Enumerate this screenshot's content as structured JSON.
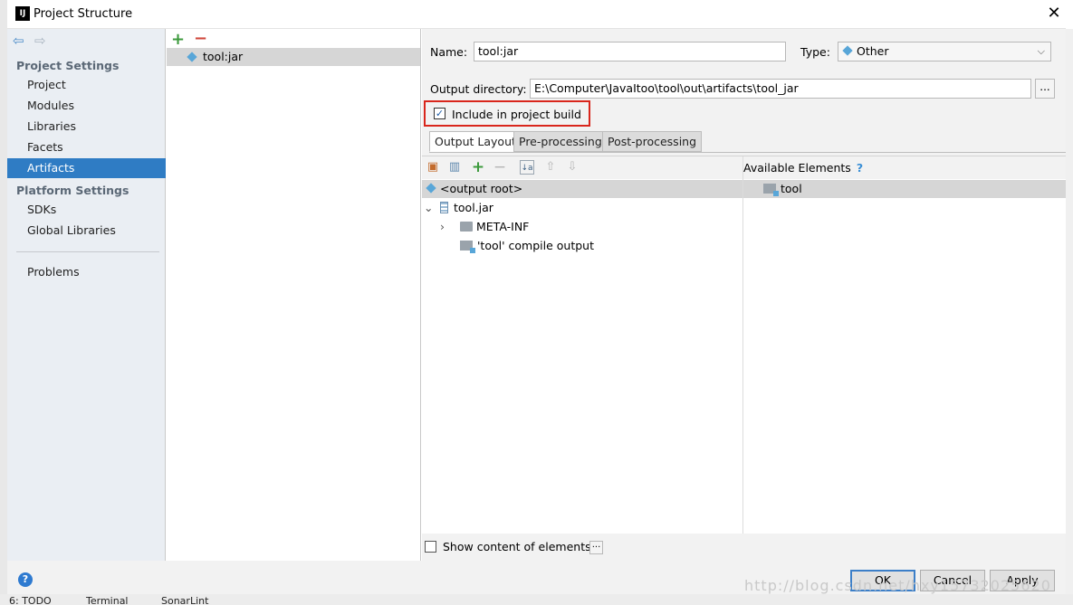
{
  "window": {
    "title": "Project Structure"
  },
  "sidebar": {
    "sections": [
      {
        "label": "Project Settings",
        "items": [
          "Project",
          "Modules",
          "Libraries",
          "Facets",
          "Artifacts"
        ]
      },
      {
        "label": "Platform Settings",
        "items": [
          "SDKs",
          "Global Libraries"
        ]
      }
    ],
    "problems": "Problems",
    "selected": "Artifacts"
  },
  "artifacts_list": {
    "items": [
      "tool:jar"
    ]
  },
  "artifact": {
    "name_label": "Name:",
    "name_value": "tool:jar",
    "type_label": "Type:",
    "type_value": "Other",
    "outdir_label": "Output directory:",
    "outdir_value": "E:\\Computer\\JavaItoo\\tool\\out\\artifacts\\tool_jar",
    "browse_label": "...",
    "include_label": "Include in project build",
    "include_checked": true
  },
  "tabs": [
    "Output Layout",
    "Pre-processing",
    "Post-processing"
  ],
  "layout_tree": {
    "root": "<output root>",
    "jar": "tool.jar",
    "meta": "META-INF",
    "compile": "'tool' compile output"
  },
  "available": {
    "title": "Available Elements",
    "items": [
      "tool"
    ]
  },
  "show_content": {
    "label": "Show content of elements",
    "checked": false,
    "more": "..."
  },
  "buttons": {
    "ok": "OK",
    "cancel": "Cancel",
    "apply": "Apply"
  },
  "statusbar": [
    "6: TODO",
    "Terminal",
    "SonarLint"
  ],
  "watermark": "http://blog.csdn.net/hxy15732025620"
}
